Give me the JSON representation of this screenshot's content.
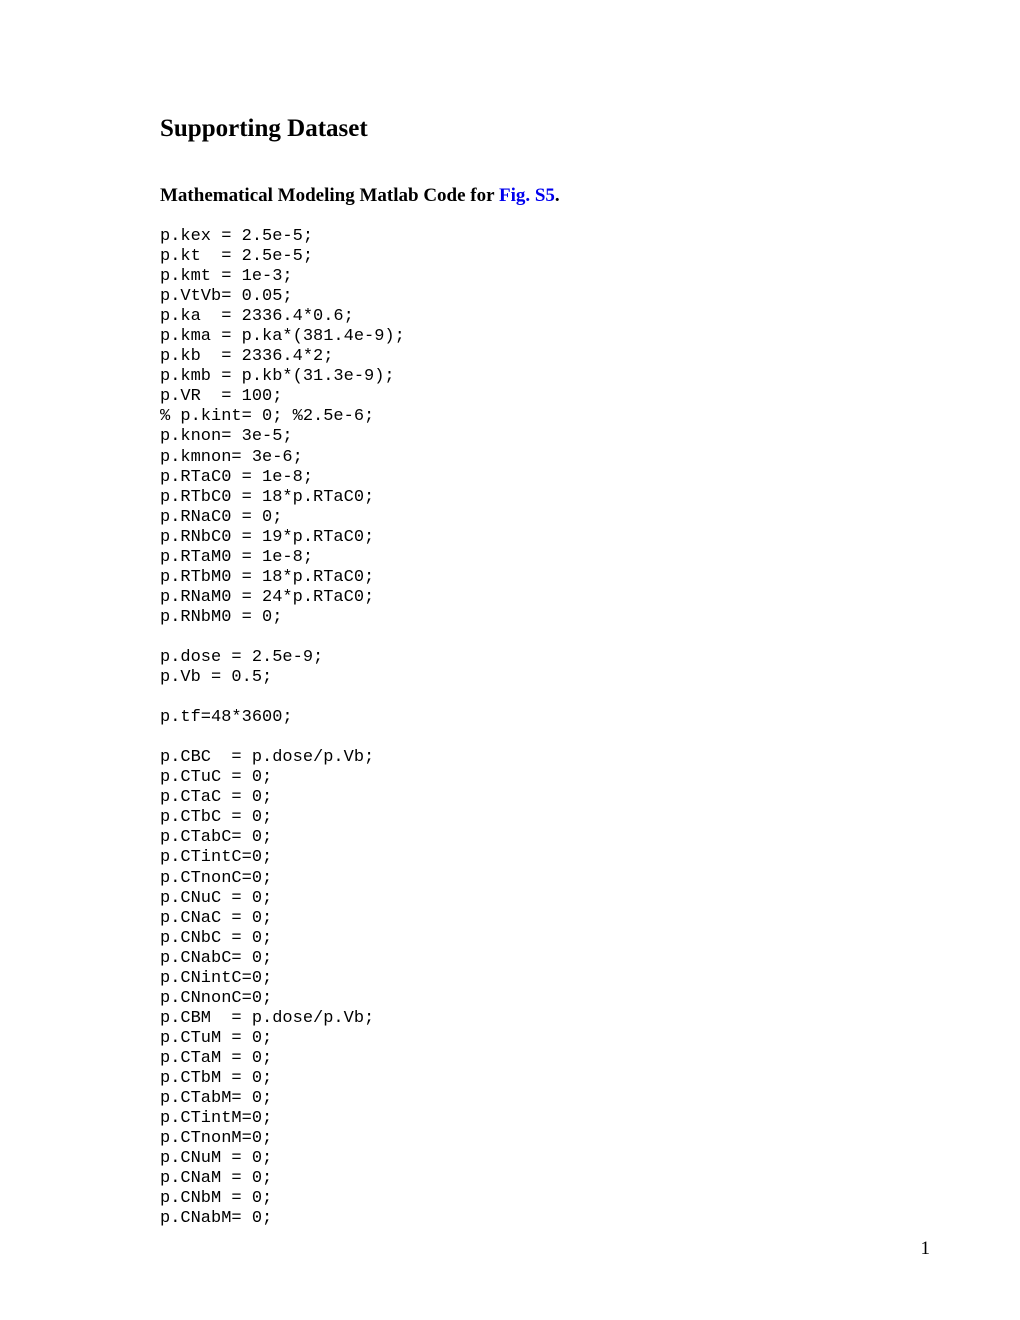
{
  "title": "Supporting Dataset",
  "subtitle_prefix": "Mathematical Modeling Matlab Code for ",
  "figure_link": "Fig. S5",
  "subtitle_suffix": ".",
  "code": "p.kex = 2.5e-5;\np.kt  = 2.5e-5;\np.kmt = 1e-3;\np.VtVb= 0.05;\np.ka  = 2336.4*0.6;\np.kma = p.ka*(381.4e-9);\np.kb  = 2336.4*2;\np.kmb = p.kb*(31.3e-9);\np.VR  = 100;\n% p.kint= 0; %2.5e-6;\np.knon= 3e-5;\np.kmnon= 3e-6;\np.RTaC0 = 1e-8;\np.RTbC0 = 18*p.RTaC0;\np.RNaC0 = 0;\np.RNbC0 = 19*p.RTaC0;\np.RTaM0 = 1e-8;\np.RTbM0 = 18*p.RTaC0;\np.RNaM0 = 24*p.RTaC0;\np.RNbM0 = 0;\n\np.dose = 2.5e-9;\np.Vb = 0.5;\n\np.tf=48*3600;\n\np.CBC  = p.dose/p.Vb;\np.CTuC = 0;\np.CTaC = 0;\np.CTbC = 0;\np.CTabC= 0;\np.CTintC=0;\np.CTnonC=0;\np.CNuC = 0;\np.CNaC = 0;\np.CNbC = 0;\np.CNabC= 0;\np.CNintC=0;\np.CNnonC=0;\np.CBM  = p.dose/p.Vb;\np.CTuM = 0;\np.CTaM = 0;\np.CTbM = 0;\np.CTabM= 0;\np.CTintM=0;\np.CTnonM=0;\np.CNuM = 0;\np.CNaM = 0;\np.CNbM = 0;\np.CNabM= 0;",
  "page_number": "1"
}
